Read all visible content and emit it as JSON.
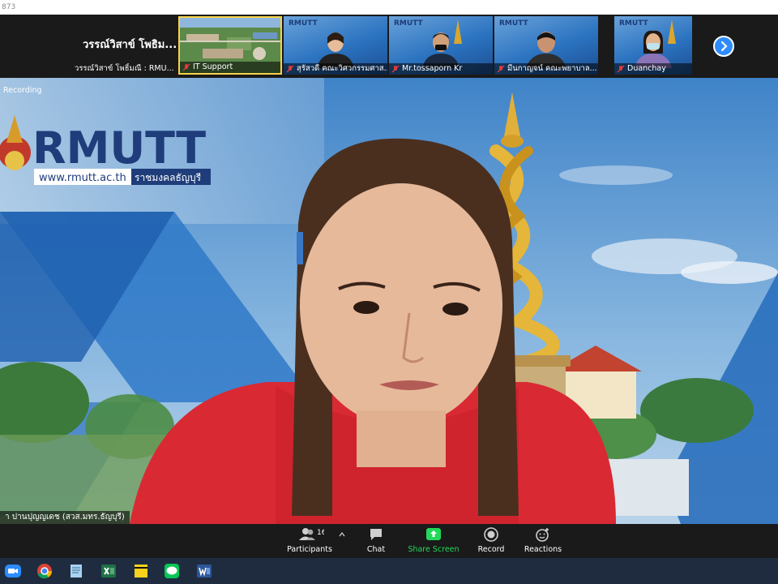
{
  "window": {
    "title_fragment": "873"
  },
  "participants_strip": {
    "first": {
      "display_name": "วรรณ์วิสาข์ โพธิม...",
      "full_name": "วรรณ์วิสาข์ โพธิ์มณี : RMU..."
    },
    "tiles": [
      {
        "name": "IT Support"
      },
      {
        "name": "สุรัสวดี คณะวิศวกรรมศาส..."
      },
      {
        "name": "Mr.tossaporn Kr"
      },
      {
        "name": "มีนกาญจน์ คณะพยาบาล..."
      },
      {
        "name": "Duanchay"
      }
    ],
    "tile_logo_text": "RMUTT"
  },
  "main_video": {
    "recording_label": "Recording",
    "background": {
      "logo_text": "RMUTT",
      "url_text": "www.rmutt.ac.th",
      "tagline": "ราชมงคลธัญบุรี"
    },
    "speaker_name": "า ปานปุญญเดช (สวส.มทร.ธัญบุรี)"
  },
  "toolbar": {
    "participants_label": "Participants",
    "participants_count": "16",
    "chat_label": "Chat",
    "share_label": "Share Screen",
    "record_label": "Record",
    "reactions_label": "Reactions"
  },
  "taskbar": {
    "apps": [
      "zoom-icon",
      "chrome-icon",
      "notepad-icon",
      "excel-icon",
      "sticky-notes-icon",
      "line-icon",
      "word-icon"
    ]
  },
  "colors": {
    "share_green": "#23d959",
    "zoom_blue": "#2d8cff",
    "toolbar_bg": "#1a1a1a"
  }
}
